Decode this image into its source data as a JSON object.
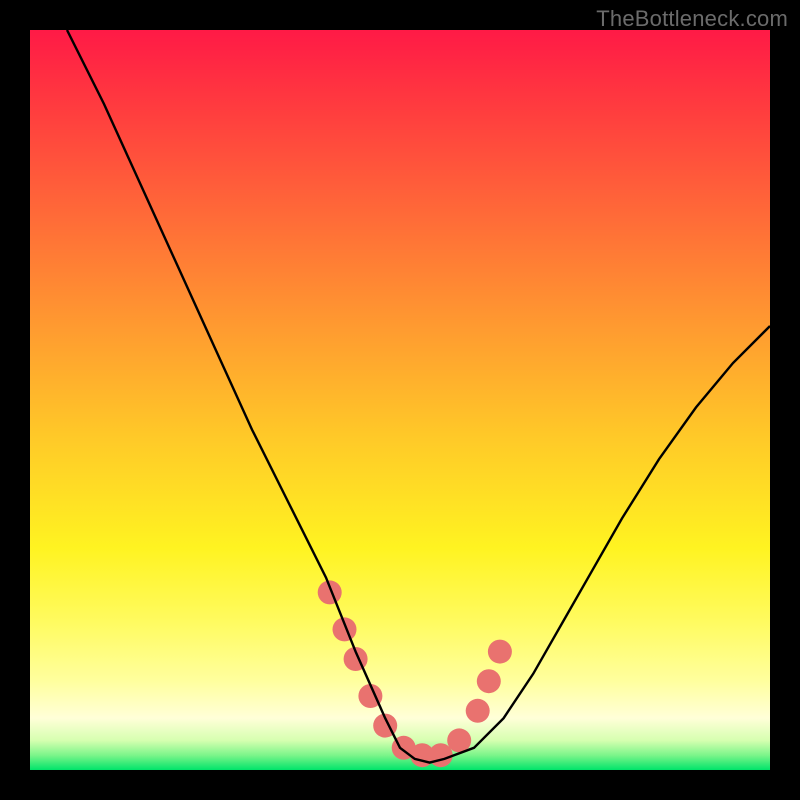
{
  "watermark": "TheBottleneck.com",
  "chart_data": {
    "type": "line",
    "title": "",
    "xlabel": "",
    "ylabel": "",
    "xlim": [
      0,
      100
    ],
    "ylim": [
      0,
      100
    ],
    "series": [
      {
        "name": "curve",
        "x": [
          5,
          10,
          15,
          20,
          25,
          30,
          35,
          40,
          44,
          48,
          50,
          52,
          54,
          56,
          60,
          64,
          68,
          72,
          76,
          80,
          85,
          90,
          95,
          100
        ],
        "y": [
          100,
          90,
          79,
          68,
          57,
          46,
          36,
          26,
          16,
          7,
          3,
          1.5,
          1,
          1.5,
          3,
          7,
          13,
          20,
          27,
          34,
          42,
          49,
          55,
          60
        ]
      }
    ],
    "markers": {
      "name": "highlight-points",
      "color": "#e9726f",
      "radius": 12,
      "x": [
        40.5,
        42.5,
        44,
        46,
        48,
        50.5,
        53,
        55.5,
        58,
        60.5,
        62,
        63.5
      ],
      "y": [
        24,
        19,
        15,
        10,
        6,
        3,
        2,
        2,
        4,
        8,
        12,
        16
      ]
    }
  }
}
